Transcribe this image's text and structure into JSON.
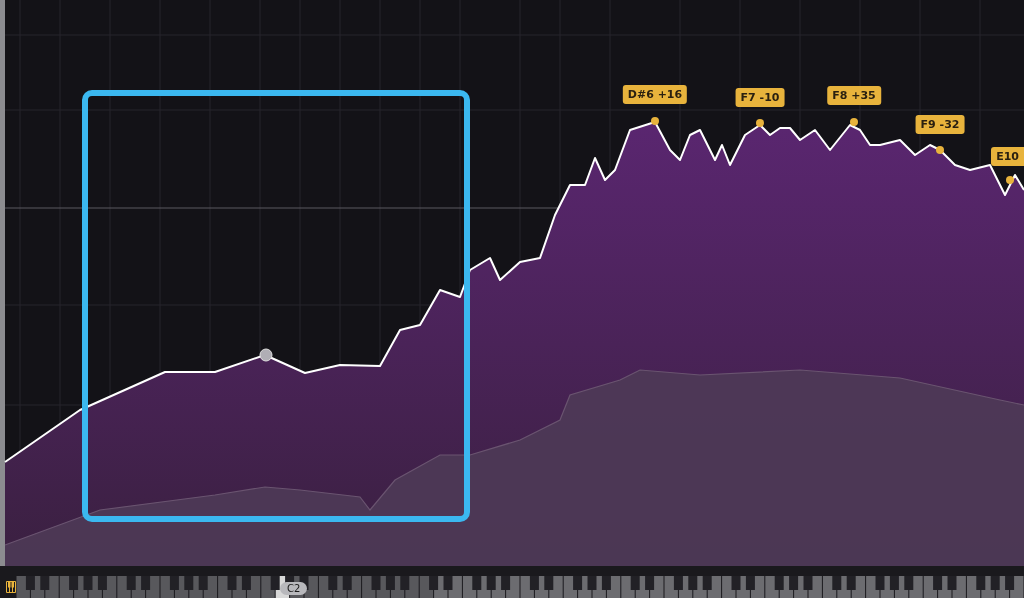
{
  "analyzer": {
    "peak_labels": [
      {
        "text": "D#6 +16"
      },
      {
        "text": "F7 -10"
      },
      {
        "text": "F8 +35"
      },
      {
        "text": "F9 -32"
      },
      {
        "text": "E10"
      }
    ]
  },
  "keyboard": {
    "note_label": "C2"
  }
}
